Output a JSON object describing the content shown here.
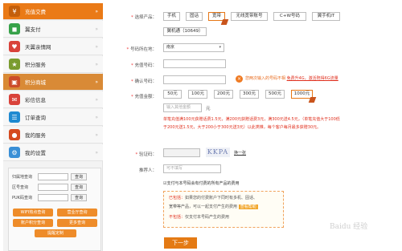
{
  "sidebar": {
    "items": [
      {
        "label": "充值交费",
        "icon": "yuan-icon",
        "color": "#ea7a17"
      },
      {
        "label": "翼支付",
        "icon": "wallet-icon",
        "color": "#37a24a"
      },
      {
        "label": "天翼亲情网",
        "icon": "family-icon",
        "color": "#d9423a"
      },
      {
        "label": "积分服务",
        "icon": "points-icon",
        "color": "#7a9c2f"
      },
      {
        "label": "积分商城",
        "icon": "shop-icon",
        "color": "#cc4b2a"
      },
      {
        "label": "彩信信息",
        "icon": "message-icon",
        "color": "#d9423a"
      },
      {
        "label": "订单查询",
        "icon": "order-icon",
        "color": "#1f8ad1"
      },
      {
        "label": "我的服务",
        "icon": "service-icon",
        "color": "#d54a1f"
      },
      {
        "label": "我的设置",
        "icon": "settings-icon",
        "color": "#3a8fd6"
      }
    ],
    "arrow": "»",
    "quick": {
      "rows": [
        {
          "label": "归属地查询",
          "btn": "查询"
        },
        {
          "label": "区号查询",
          "btn": "查询"
        },
        {
          "label": "PUK码查询",
          "btn": "查询"
        }
      ],
      "buttons": [
        "WIFI热点查询",
        "营业厅查询",
        "账户积分查询",
        "更多查询"
      ],
      "remind": "提醒定制"
    }
  },
  "form": {
    "product_label": "选择产品：",
    "products": [
      "手机",
      "固话",
      "宽带",
      "无线宽带账号",
      "C+W号码",
      "翼手机IT",
      "翼机通（10649）"
    ],
    "selected_product": "宽带",
    "region_label": "号码所在地：",
    "region_value": "南京",
    "number_label": "充值号码：",
    "confirm_label": "确认号码：",
    "confirm_warning": "您两次输入的号码不相",
    "confirm_link": "免费升4G，激活既得6G流量",
    "amount_label": "充值金额：",
    "amounts": [
      "50元",
      "100元",
      "200元",
      "300元",
      "500元",
      "1000元"
    ],
    "selected_amount": "1000元",
    "other_amount_placeholder": "输入其他金额",
    "other_amount_unit": "元",
    "promo_lines": [
      "单笔充值满100元获赠话费1.5元，满200元获赠话费3元，满300元送4.5元，（单笔充值大于100低",
      "于200元送1.5元，大于200小于300元送3元）以此类推，每个客户每月最多获赠30元。"
    ],
    "captcha_label": "验证码：",
    "captcha_text": "KKPA",
    "captcha_refresh": "换一张",
    "recommender_label": "推荐人：",
    "recommender_placeholder": "可不填写",
    "agree_text": "☑支付与本号码会有付费的所有产品的费用",
    "notice": {
      "line1_head": "已包括：",
      "line1": "如果您的付费账户下同时有多机、固话、",
      "line2": "宽带等产品，可以一起支付产生的费用",
      "line2_tag": "查看帮助",
      "line3_head": "不包括：",
      "line3": "仅支付本号码产生的费用"
    },
    "submit": "下一步"
  },
  "watermark": "Baidu 经验"
}
